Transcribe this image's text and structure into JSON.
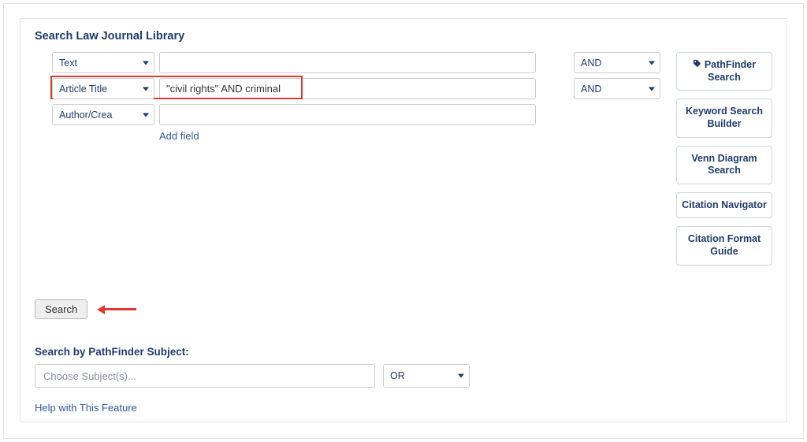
{
  "heading": "Search Law Journal Library",
  "rows": [
    {
      "field": "Text",
      "value": "",
      "op": "AND"
    },
    {
      "field": "Article Title",
      "value": "\"civil rights\" AND criminal",
      "op": "AND"
    },
    {
      "field": "Author/Crea",
      "value": "",
      "op": ""
    }
  ],
  "add_field": "Add field",
  "side": {
    "pathfinder": "PathFinder Search",
    "keyword": "Keyword Search Builder",
    "venn": "Venn Diagram Search",
    "citation": "Citation Navigator",
    "format": "Citation Format Guide"
  },
  "search_button": "Search",
  "subject_heading": "Search by PathFinder Subject:",
  "subject_placeholder": "Choose Subject(s)...",
  "subject_op": "OR",
  "help_link": "Help with This Feature"
}
